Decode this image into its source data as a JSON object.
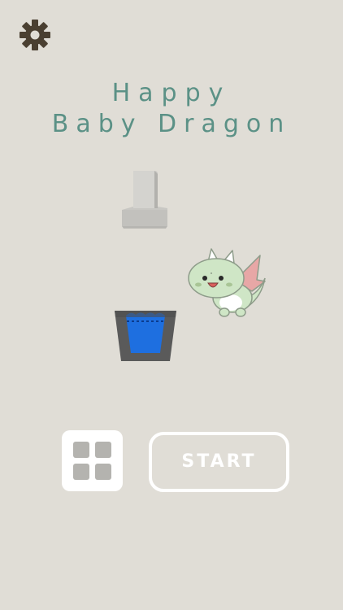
{
  "title": {
    "line1": "Happy",
    "line2": "Baby Dragon"
  },
  "buttons": {
    "start_label": "START",
    "settings_icon": "gear-icon",
    "menu_icon": "grid-icon"
  },
  "colors": {
    "background": "#e0ddd6",
    "title": "#5b9186",
    "gear": "#4a3f31",
    "button_fill": "#ffffff",
    "grid_cells": "#b4b3af",
    "water": "#1e6fe0",
    "cup": "#5a5a5a",
    "pillar": "#c8c7c3",
    "dragon_body": "#cfe6c6",
    "dragon_wing": "#e7a7a6"
  }
}
